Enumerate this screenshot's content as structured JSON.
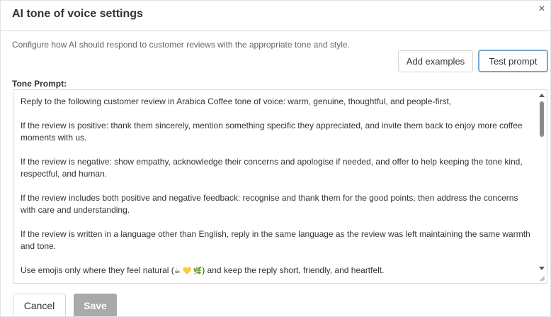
{
  "dialog": {
    "title": "AI tone of voice settings",
    "close_icon": "×",
    "description": "Configure how AI should respond to customer reviews with the appropriate tone and style."
  },
  "actions": {
    "add_examples_label": "Add examples",
    "test_prompt_label": "Test prompt"
  },
  "prompt": {
    "label": "Tone Prompt:",
    "paragraphs": [
      "Reply to the following customer review in Arabica Coffee tone of voice: warm, genuine, thoughtful, and people-first,",
      "If the review is positive: thank them sincerely, mention something specific they appreciated, and invite them back to enjoy more coffee moments with us.",
      "If the review is negative: show empathy, acknowledge their concerns and apologise if needed, and offer to help keeping the tone kind, respectful, and human.",
      "If the review includes both positive and negative feedback: recognise and thank them for the good points, then address the concerns with care and understanding.",
      "If the review is written in a language other than English, reply in the same language as the review was left maintaining the same warmth and tone."
    ],
    "last_paragraph": {
      "before": "Use emojis only where they feel natural (",
      "emojis": "☕ 💛 🌿",
      "after": ") and keep the reply short, friendly, and heartfelt."
    }
  },
  "footer": {
    "cancel_label": "Cancel",
    "save_label": "Save"
  },
  "icons": {
    "close": "close-icon",
    "scroll_up": "scroll-up-arrow-icon",
    "scroll_down": "scroll-down-arrow-icon",
    "resize": "resize-handle-icon"
  },
  "colors": {
    "test_prompt_border": "#7da5d1",
    "save_bg": "#a9a9a9",
    "scroll_thumb": "#8a8a8a"
  }
}
